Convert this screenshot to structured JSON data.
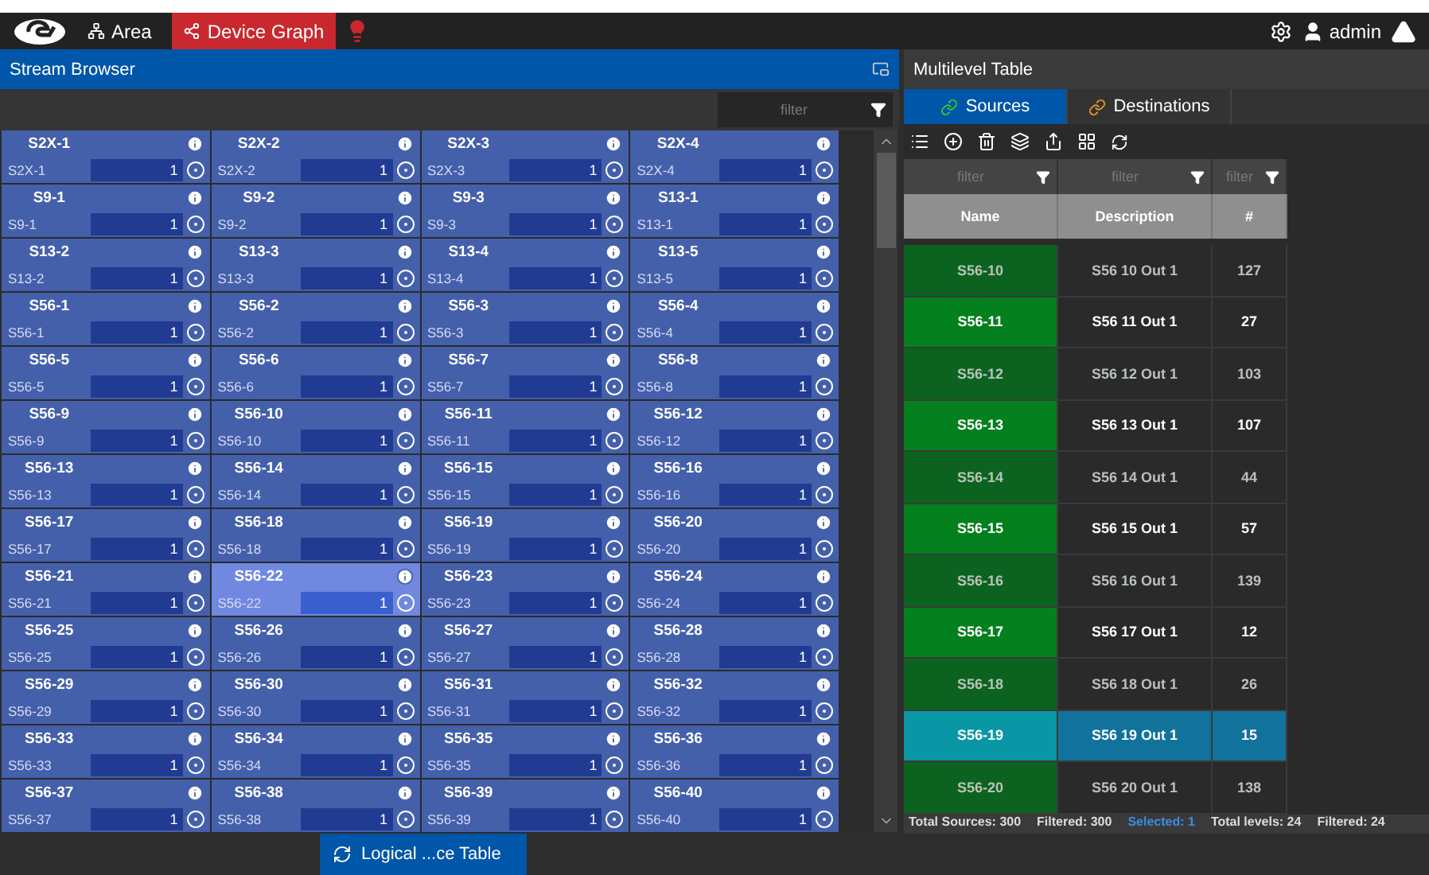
{
  "top_bar": {
    "nav": [
      {
        "label": "Area",
        "selected": false,
        "kind": "area"
      },
      {
        "label": "Device Graph",
        "selected": true,
        "kind": "graph"
      }
    ],
    "user": "admin"
  },
  "stream_browser": {
    "title": "Stream Browser",
    "filter_placeholder": "filter",
    "cells": [
      {
        "title": "S2X-1",
        "sub": "S2X-1",
        "value": "1",
        "selected": false
      },
      {
        "title": "S2X-2",
        "sub": "S2X-2",
        "value": "1",
        "selected": false
      },
      {
        "title": "S2X-3",
        "sub": "S2X-3",
        "value": "1",
        "selected": false
      },
      {
        "title": "S2X-4",
        "sub": "S2X-4",
        "value": "1",
        "selected": false
      },
      {
        "title": "S9-1",
        "sub": "S9-1",
        "value": "1",
        "selected": false
      },
      {
        "title": "S9-2",
        "sub": "S9-2",
        "value": "1",
        "selected": false
      },
      {
        "title": "S9-3",
        "sub": "S9-3",
        "value": "1",
        "selected": false
      },
      {
        "title": "S13-1",
        "sub": "S13-1",
        "value": "1",
        "selected": false
      },
      {
        "title": "S13-2",
        "sub": "S13-2",
        "value": "1",
        "selected": false
      },
      {
        "title": "S13-3",
        "sub": "S13-3",
        "value": "1",
        "selected": false
      },
      {
        "title": "S13-4",
        "sub": "S13-4",
        "value": "1",
        "selected": false
      },
      {
        "title": "S13-5",
        "sub": "S13-5",
        "value": "1",
        "selected": false
      },
      {
        "title": "S56-1",
        "sub": "S56-1",
        "value": "1",
        "selected": false
      },
      {
        "title": "S56-2",
        "sub": "S56-2",
        "value": "1",
        "selected": false
      },
      {
        "title": "S56-3",
        "sub": "S56-3",
        "value": "1",
        "selected": false
      },
      {
        "title": "S56-4",
        "sub": "S56-4",
        "value": "1",
        "selected": false
      },
      {
        "title": "S56-5",
        "sub": "S56-5",
        "value": "1",
        "selected": false
      },
      {
        "title": "S56-6",
        "sub": "S56-6",
        "value": "1",
        "selected": false
      },
      {
        "title": "S56-7",
        "sub": "S56-7",
        "value": "1",
        "selected": false
      },
      {
        "title": "S56-8",
        "sub": "S56-8",
        "value": "1",
        "selected": false
      },
      {
        "title": "S56-9",
        "sub": "S56-9",
        "value": "1",
        "selected": false
      },
      {
        "title": "S56-10",
        "sub": "S56-10",
        "value": "1",
        "selected": false
      },
      {
        "title": "S56-11",
        "sub": "S56-11",
        "value": "1",
        "selected": false
      },
      {
        "title": "S56-12",
        "sub": "S56-12",
        "value": "1",
        "selected": false
      },
      {
        "title": "S56-13",
        "sub": "S56-13",
        "value": "1",
        "selected": false
      },
      {
        "title": "S56-14",
        "sub": "S56-14",
        "value": "1",
        "selected": false
      },
      {
        "title": "S56-15",
        "sub": "S56-15",
        "value": "1",
        "selected": false
      },
      {
        "title": "S56-16",
        "sub": "S56-16",
        "value": "1",
        "selected": false
      },
      {
        "title": "S56-17",
        "sub": "S56-17",
        "value": "1",
        "selected": false
      },
      {
        "title": "S56-18",
        "sub": "S56-18",
        "value": "1",
        "selected": false
      },
      {
        "title": "S56-19",
        "sub": "S56-19",
        "value": "1",
        "selected": false
      },
      {
        "title": "S56-20",
        "sub": "S56-20",
        "value": "1",
        "selected": false
      },
      {
        "title": "S56-21",
        "sub": "S56-21",
        "value": "1",
        "selected": false
      },
      {
        "title": "S56-22",
        "sub": "S56-22",
        "value": "1",
        "selected": true
      },
      {
        "title": "S56-23",
        "sub": "S56-23",
        "value": "1",
        "selected": false
      },
      {
        "title": "S56-24",
        "sub": "S56-24",
        "value": "1",
        "selected": false
      },
      {
        "title": "S56-25",
        "sub": "S56-25",
        "value": "1",
        "selected": false
      },
      {
        "title": "S56-26",
        "sub": "S56-26",
        "value": "1",
        "selected": false
      },
      {
        "title": "S56-27",
        "sub": "S56-27",
        "value": "1",
        "selected": false
      },
      {
        "title": "S56-28",
        "sub": "S56-28",
        "value": "1",
        "selected": false
      },
      {
        "title": "S56-29",
        "sub": "S56-29",
        "value": "1",
        "selected": false
      },
      {
        "title": "S56-30",
        "sub": "S56-30",
        "value": "1",
        "selected": false
      },
      {
        "title": "S56-31",
        "sub": "S56-31",
        "value": "1",
        "selected": false
      },
      {
        "title": "S56-32",
        "sub": "S56-32",
        "value": "1",
        "selected": false
      },
      {
        "title": "S56-33",
        "sub": "S56-33",
        "value": "1",
        "selected": false
      },
      {
        "title": "S56-34",
        "sub": "S56-34",
        "value": "1",
        "selected": false
      },
      {
        "title": "S56-35",
        "sub": "S56-35",
        "value": "1",
        "selected": false
      },
      {
        "title": "S56-36",
        "sub": "S56-36",
        "value": "1",
        "selected": false
      },
      {
        "title": "S56-37",
        "sub": "S56-37",
        "value": "1",
        "selected": false
      },
      {
        "title": "S56-38",
        "sub": "S56-38",
        "value": "1",
        "selected": false
      },
      {
        "title": "S56-39",
        "sub": "S56-39",
        "value": "1",
        "selected": false
      },
      {
        "title": "S56-40",
        "sub": "S56-40",
        "value": "1",
        "selected": false
      }
    ]
  },
  "multilevel_table": {
    "title": "Multilevel Table",
    "tabs": [
      {
        "label": "Sources",
        "selected": true
      },
      {
        "label": "Destinations",
        "selected": false
      }
    ],
    "filter_placeholders": [
      "filter",
      "filter",
      "filter"
    ],
    "columns": [
      "Name",
      "Description",
      "#"
    ],
    "rows": [
      {
        "name": "S56-10",
        "description": "S56 10 Out 1",
        "number": "127",
        "active": false,
        "selected": false
      },
      {
        "name": "S56-11",
        "description": "S56 11 Out 1",
        "number": "27",
        "active": true,
        "selected": false
      },
      {
        "name": "S56-12",
        "description": "S56 12 Out 1",
        "number": "103",
        "active": false,
        "selected": false
      },
      {
        "name": "S56-13",
        "description": "S56 13 Out 1",
        "number": "107",
        "active": true,
        "selected": false
      },
      {
        "name": "S56-14",
        "description": "S56 14 Out 1",
        "number": "44",
        "active": false,
        "selected": false
      },
      {
        "name": "S56-15",
        "description": "S56 15 Out 1",
        "number": "57",
        "active": true,
        "selected": false
      },
      {
        "name": "S56-16",
        "description": "S56 16 Out 1",
        "number": "139",
        "active": false,
        "selected": false
      },
      {
        "name": "S56-17",
        "description": "S56 17 Out 1",
        "number": "12",
        "active": true,
        "selected": false
      },
      {
        "name": "S56-18",
        "description": "S56 18 Out 1",
        "number": "26",
        "active": false,
        "selected": false
      },
      {
        "name": "S56-19",
        "description": "S56 19 Out 1",
        "number": "15",
        "active": false,
        "selected": true
      },
      {
        "name": "S56-20",
        "description": "S56 20 Out 1",
        "number": "138",
        "active": false,
        "selected": false
      }
    ],
    "status": [
      {
        "text": "Total Sources: 300",
        "kind": "plain"
      },
      {
        "text": "Filtered: 300",
        "kind": "plain"
      },
      {
        "text": "Selected: 1",
        "kind": "accent"
      },
      {
        "text": "Total levels: 24",
        "kind": "plain"
      },
      {
        "text": "Filtered: 24",
        "kind": "plain"
      }
    ]
  },
  "bottom_tab": {
    "label": "Logical ...ce Table"
  }
}
